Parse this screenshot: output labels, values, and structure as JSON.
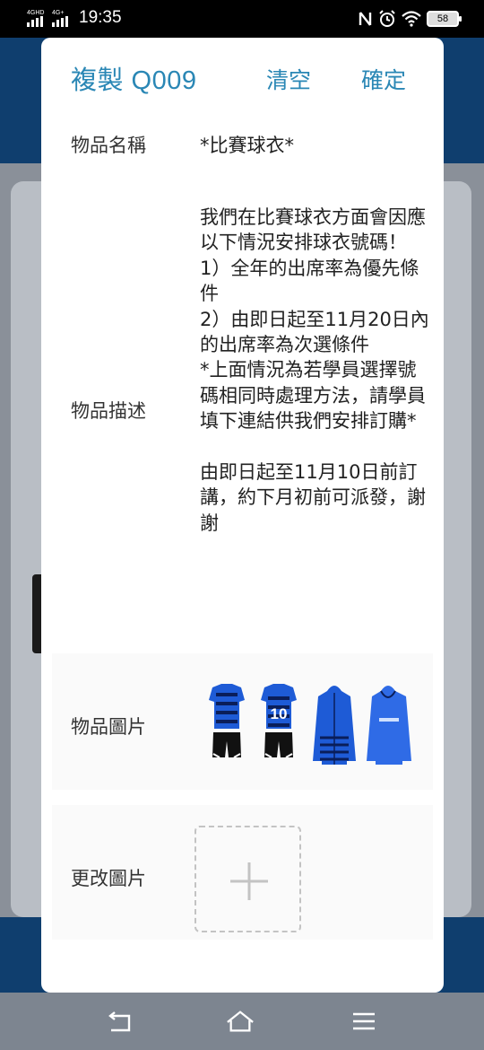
{
  "status_bar": {
    "network": "4GHD 4G+",
    "time": "19:35",
    "battery": "58",
    "icons": [
      "nfc-icon",
      "alarm-icon",
      "wifi-icon",
      "battery-icon"
    ]
  },
  "dialog": {
    "title": "複製 Q009",
    "clear_label": "清空",
    "confirm_label": "確定",
    "fields": {
      "name_label": "物品名稱",
      "name_value": "*比賽球衣*",
      "desc_label": "物品描述",
      "desc_value": "我們在比賽球衣方面會因應以下情況安排球衣號碼！\n1）全年的出席率為優先條件\n2）由即日起至11月20日內的出席率為次選條件\n*上面情況為若學員選擇號碼相同時處理方法，請學員填下連結供我們安排訂購*\n\n由即日起至11月10日前訂講，約下月初前可派發，謝謝",
      "pic_label": "物品圖片",
      "change_label": "更改圖片"
    }
  },
  "nav": {
    "icons": [
      "back-icon",
      "home-icon",
      "menu-icon"
    ]
  },
  "colors": {
    "accent": "#2a87b5",
    "brand_dark": "#0f3e6e",
    "jersey_blue": "#1e5bd6"
  }
}
